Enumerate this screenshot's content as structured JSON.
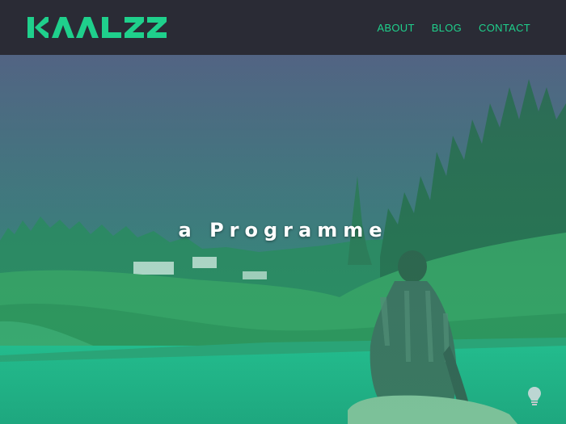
{
  "brand": {
    "logo_text": "KAALZZ",
    "accent_color": "#1fd08c",
    "header_bg": "#2a2b35"
  },
  "nav": {
    "items": [
      {
        "label": "ABOUT"
      },
      {
        "label": "BLOG"
      },
      {
        "label": "CONTACT"
      }
    ]
  },
  "hero": {
    "headline": "a Programme",
    "overlay_colors": [
      "#4a5a7a",
      "#1fb27c"
    ],
    "background_image": "man-sitting-by-lake"
  },
  "widgets": {
    "bulb_icon": "lightbulb-icon"
  }
}
